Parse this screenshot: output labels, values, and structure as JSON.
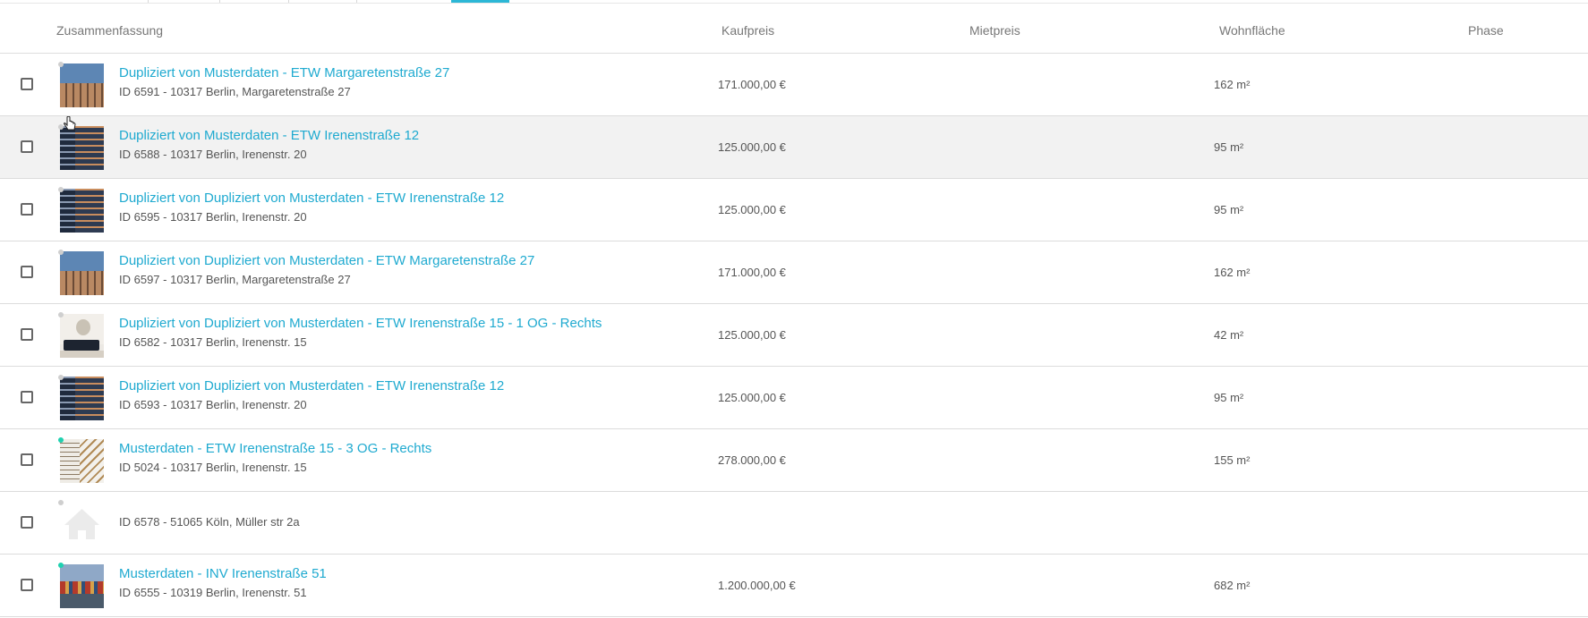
{
  "columns": {
    "summary": "Zusammenfassung",
    "purchase_price": "Kaufpreis",
    "rent": "Mietpreis",
    "living_area": "Wohnfläche",
    "phase": "Phase"
  },
  "colors": {
    "accent": "#2cb7d6",
    "link": "#1faad0",
    "status_active": "#1fd1b0",
    "status_inactive": "#cfcfcf"
  },
  "rows": [
    {
      "title": "Dupliziert von Musterdaten - ETW Margaretenstraße 27",
      "subtitle": "ID 6591 - 10317 Berlin, Margaretenstraße 27",
      "price": "171.000,00 €",
      "area": "162 m²",
      "status": "inactive",
      "thumb": "building-photo"
    },
    {
      "title": "Dupliziert von Musterdaten - ETW Irenenstraße 12",
      "subtitle": "ID 6588 - 10317 Berlin, Irenenstr. 20",
      "price": "125.000,00 €",
      "area": "95 m²",
      "status": "inactive",
      "thumb": "building-dark-photo"
    },
    {
      "title": "Dupliziert von Dupliziert von Musterdaten - ETW Irenenstraße 12",
      "subtitle": "ID 6595 - 10317 Berlin, Irenenstr. 20",
      "price": "125.000,00 €",
      "area": "95 m²",
      "status": "inactive",
      "thumb": "building-dark-photo"
    },
    {
      "title": "Dupliziert von Dupliziert von Musterdaten - ETW Margaretenstraße 27",
      "subtitle": "ID 6597 - 10317 Berlin, Margaretenstraße 27",
      "price": "171.000,00 €",
      "area": "162 m²",
      "status": "inactive",
      "thumb": "building-photo"
    },
    {
      "title": "Dupliziert von Dupliziert von Musterdaten - ETW Irenenstraße 15 - 1 OG - Rechts",
      "subtitle": "ID 6582 - 10317 Berlin, Irenenstr. 15",
      "price": "125.000,00 €",
      "area": "42 m²",
      "status": "inactive",
      "thumb": "room-photo"
    },
    {
      "title": "Dupliziert von Dupliziert von Musterdaten - ETW Irenenstraße 12",
      "subtitle": "ID 6593 - 10317 Berlin, Irenenstr. 20",
      "price": "125.000,00 €",
      "area": "95 m²",
      "status": "inactive",
      "thumb": "building-dark-photo"
    },
    {
      "title": "Musterdaten - ETW Irenenstraße 15 - 3 OG - Rechts",
      "subtitle": "ID 5024 - 10317 Berlin, Irenenstr. 15",
      "price": "278.000,00 €",
      "area": "155 m²",
      "status": "active",
      "thumb": "staircase-photo"
    },
    {
      "title": "",
      "subtitle": "ID 6578 - 51065 Köln, Müller str 2a",
      "price": "",
      "area": "",
      "status": "inactive",
      "thumb": "house-placeholder-icon"
    },
    {
      "title": "Musterdaten - INV Irenenstraße 51",
      "subtitle": "ID 6555 - 10319 Berlin, Irenenstr. 51",
      "price": "1.200.000,00 €",
      "area": "682 m²",
      "status": "active",
      "thumb": "harbor-photo"
    }
  ]
}
